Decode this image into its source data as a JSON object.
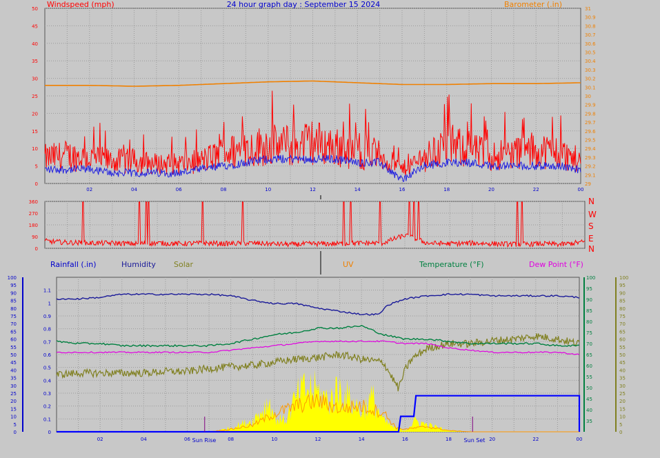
{
  "title": "24 hour graph day : September 15 2024",
  "colors": {
    "background": "#c8c8c8",
    "grid": "#8c8c8c",
    "wind": "#ff0000",
    "wind_avg": "#2020e0",
    "barometer": "#f08000",
    "rain": "#0000ff",
    "humidity": "#1a1a99",
    "solar": "#808020",
    "uv": "#ff9900",
    "temperature": "#008040",
    "dewpoint": "#e000e0",
    "solar_fill": "#ffff00"
  },
  "labels": {
    "windspeed": "Windspeed (mph)",
    "barometer": "Barometer (.in)",
    "rainfall": "Rainfall (.in)",
    "humidity": "Humidity",
    "solar": "Solar",
    "uv": "UV",
    "temperature": "Temperature (°F)",
    "dewpoint": "Dew Point (°F)",
    "sunrise": "Sun Rise",
    "sunset": "Sun Set"
  },
  "chart_data": [
    {
      "type": "line",
      "panel": "wind",
      "title": "24 hour graph day : September 15 2024",
      "xlabel": "",
      "x_ticks": [
        "02",
        "04",
        "06",
        "08",
        "10",
        "12",
        "14",
        "16",
        "18",
        "20",
        "22",
        "00"
      ],
      "ylabel_left": "Windspeed (mph)",
      "ylim_left": [
        0,
        50
      ],
      "yticks_left": [
        0,
        5,
        10,
        15,
        20,
        25,
        30,
        35,
        40,
        45,
        50
      ],
      "ylabel_right": "Barometer (.in)",
      "ylim_right": [
        29,
        31
      ],
      "yticks_right": [
        "29",
        "29.1",
        "29.2",
        "29.3",
        "29.4",
        "29.5",
        "29.6",
        "29.7",
        "29.8",
        "29.9",
        "30",
        "30.1",
        "30.2",
        "30.3",
        "30.4",
        "30.5",
        "30.6",
        "30.7",
        "30.8",
        "30.9",
        "31"
      ],
      "series": [
        {
          "name": "Windspeed (mph)",
          "axis": "left",
          "x": [
            0,
            1,
            2,
            3,
            4,
            5,
            6,
            7,
            8,
            9,
            10,
            11,
            12,
            13,
            14,
            15,
            16,
            17,
            18,
            19,
            20,
            21,
            22,
            23,
            24
          ],
          "gust": [
            9,
            10,
            9,
            8,
            8,
            7,
            7,
            8,
            11,
            12,
            14,
            13,
            15,
            13,
            11,
            10,
            5,
            9,
            14,
            12,
            10,
            11,
            12,
            11,
            8
          ],
          "avg": [
            4,
            4,
            4,
            3,
            3,
            3,
            3,
            4,
            5,
            6,
            7,
            7,
            7,
            7,
            6,
            6,
            1,
            5,
            6,
            6,
            5,
            5,
            5,
            5,
            4
          ]
        },
        {
          "name": "Barometer (.in)",
          "axis": "right",
          "x": [
            0,
            2,
            4,
            6,
            8,
            10,
            12,
            14,
            16,
            18,
            20,
            22,
            24
          ],
          "values": [
            30.12,
            30.12,
            30.11,
            30.12,
            30.14,
            30.16,
            30.17,
            30.15,
            30.13,
            30.13,
            30.14,
            30.14,
            30.15
          ]
        }
      ]
    },
    {
      "type": "line",
      "panel": "wind_direction",
      "y_ticks_left": [
        0,
        90,
        180,
        270,
        360
      ],
      "y_ticks_right": [
        "N",
        "W",
        "S",
        "E",
        "N"
      ],
      "series": [
        {
          "name": "Wind Direction",
          "x": [
            0,
            1,
            2,
            3,
            4,
            5,
            6,
            7,
            8,
            9,
            10,
            11,
            12,
            13,
            14,
            15,
            16,
            17,
            18,
            19,
            20,
            21,
            22,
            23,
            24
          ],
          "values": [
            55,
            45,
            40,
            40,
            35,
            40,
            35,
            40,
            35,
            40,
            35,
            30,
            35,
            35,
            40,
            40,
            100,
            40,
            35,
            40,
            35,
            30,
            35,
            30,
            50
          ],
          "spikes_at_x": [
            1.7,
            4.2,
            4.5,
            4.6,
            7.0,
            8.8,
            13.3,
            13.6,
            14.9,
            16.2,
            16.4,
            16.6,
            21.0,
            21.2
          ]
        }
      ]
    },
    {
      "type": "line",
      "panel": "weather",
      "x_ticks": [
        "02",
        "04",
        "06",
        "08",
        "10",
        "12",
        "14",
        "16",
        "18",
        "20",
        "22",
        "00"
      ],
      "sunrise_x": 6.8,
      "sunset_x": 19.1,
      "rain_axis": {
        "label": "Rainfall (.in)",
        "ylim": [
          0,
          1.2
        ],
        "ticks": [
          "0",
          "0.1",
          "0.2",
          "0.3",
          "0.4",
          "0.5",
          "0.6",
          "0.7",
          "0.8",
          "0.9",
          "1",
          "1.1"
        ]
      },
      "humidity_axis": {
        "label": "Humidity",
        "ylim": [
          0,
          100
        ],
        "ticks": [
          0,
          5,
          10,
          15,
          20,
          25,
          30,
          35,
          40,
          45,
          50,
          55,
          60,
          65,
          70,
          75,
          80,
          85,
          90,
          95,
          100
        ]
      },
      "temperature_axis": {
        "label": "Temperature (°F)",
        "ylim": [
          30,
          100
        ],
        "ticks": [
          35,
          40,
          45,
          50,
          55,
          60,
          65,
          70,
          75,
          80,
          85,
          90,
          95,
          100
        ]
      },
      "solar_axis": {
        "label": "Solar",
        "ylim": [
          0,
          100
        ],
        "ticks": [
          0,
          5,
          10,
          15,
          20,
          25,
          30,
          35,
          40,
          45,
          50,
          55,
          60,
          65,
          70,
          75,
          80,
          85,
          90,
          95,
          100
        ]
      },
      "series": [
        {
          "name": "Humidity",
          "axis": "humidity",
          "x": [
            0,
            1,
            2,
            3,
            4,
            5,
            6,
            7,
            8,
            9,
            10,
            11,
            12,
            13,
            14,
            14.8,
            15.2,
            16,
            17,
            18,
            19,
            20,
            21,
            22,
            23,
            24
          ],
          "values": [
            86,
            86,
            87,
            89,
            89,
            89,
            89,
            89,
            88,
            85,
            83,
            83,
            80,
            78,
            76,
            76,
            82,
            86,
            88,
            89,
            89,
            88,
            88,
            88,
            88,
            87
          ]
        },
        {
          "name": "Temperature (°F)",
          "axis": "temperature",
          "x": [
            0,
            1,
            2,
            3,
            4,
            5,
            6,
            7,
            8,
            9,
            10,
            11,
            12,
            13,
            14,
            15,
            16,
            17,
            18,
            19,
            20,
            21,
            22,
            23,
            24
          ],
          "values": [
            71,
            70,
            70,
            69,
            69,
            69,
            69,
            69,
            70,
            72,
            74,
            75,
            77,
            77,
            78,
            74,
            72,
            72,
            71,
            70,
            70,
            70,
            70,
            69,
            69
          ]
        },
        {
          "name": "Dew Point (°F)",
          "axis": "temperature",
          "x": [
            0,
            1,
            2,
            3,
            4,
            5,
            6,
            7,
            8,
            9,
            10,
            11,
            12,
            13,
            14,
            15,
            16,
            17,
            18,
            19,
            20,
            21,
            22,
            23,
            24
          ],
          "values": [
            66,
            66,
            66,
            66,
            66,
            66,
            66,
            66,
            67,
            68,
            69,
            70,
            71,
            71,
            71,
            71,
            70,
            70,
            68,
            67,
            66,
            66,
            66,
            66,
            65
          ]
        },
        {
          "name": "Solar",
          "axis": "solar",
          "x": [
            0,
            1,
            2,
            3,
            4,
            5,
            6,
            7,
            8,
            9,
            10,
            11,
            12,
            13,
            14,
            15,
            15.7,
            16,
            16.3,
            17,
            18,
            19,
            20,
            21,
            22,
            23,
            24
          ],
          "values": [
            37,
            38,
            38,
            38,
            38,
            39,
            39,
            41,
            42,
            43,
            45,
            47,
            48,
            50,
            47,
            45,
            28,
            40,
            47,
            54,
            57,
            57,
            59,
            60,
            62,
            60,
            57
          ]
        },
        {
          "name": "Solar Radiation Fill",
          "axis": "solar",
          "x": [
            0,
            6.8,
            7.5,
            8,
            9,
            9.8,
            10,
            10.5,
            11,
            11.5,
            12,
            12.5,
            13,
            13.5,
            14,
            14.5,
            15,
            15.5,
            16,
            16.5,
            17,
            18,
            19,
            20,
            24
          ],
          "values": [
            0,
            0,
            1,
            3,
            8,
            22,
            10,
            8,
            24,
            31,
            28,
            22,
            31,
            22,
            15,
            24,
            8,
            3,
            1,
            8,
            5,
            1,
            0,
            0,
            0
          ]
        },
        {
          "name": "UV",
          "axis": "rain",
          "x": [
            0,
            7,
            8,
            9,
            10,
            11,
            12,
            13,
            14,
            15,
            15.6,
            16,
            17,
            18,
            19,
            20,
            24
          ],
          "values": [
            0,
            0,
            0.02,
            0.05,
            0.14,
            0.2,
            0.24,
            0.18,
            0.2,
            0.15,
            0.03,
            0.02,
            0.04,
            0.01,
            0,
            0,
            0
          ]
        },
        {
          "name": "Rainfall (.in)",
          "axis": "rain",
          "x": [
            0,
            15.7,
            15.8,
            16.4,
            16.5,
            24,
            24.05
          ],
          "values": [
            0,
            0,
            0.12,
            0.12,
            0.28,
            0.28,
            0
          ]
        }
      ]
    }
  ]
}
